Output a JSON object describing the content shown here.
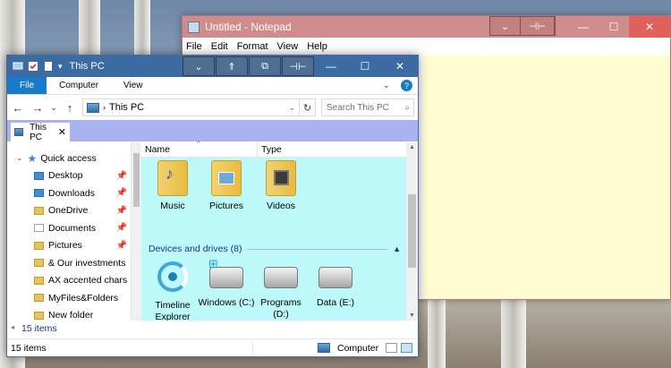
{
  "notepad": {
    "title": "Untitled - Notepad",
    "menu": [
      "File",
      "Edit",
      "Format",
      "View",
      "Help"
    ],
    "extra_buttons": [
      "chevron",
      "pin"
    ],
    "text_bg": "#fffdcf"
  },
  "explorer": {
    "title": "This PC",
    "ribbon_tabs": [
      "File",
      "Computer",
      "View"
    ],
    "address": "This PC",
    "search_placeholder": "Search This PC",
    "tab_label": "This PC",
    "nav_items": [
      {
        "label": "Quick access",
        "icon": "star-icon"
      },
      {
        "label": "Desktop",
        "pinned": true
      },
      {
        "label": "Downloads",
        "pinned": true
      },
      {
        "label": "OneDrive",
        "pinned": true
      },
      {
        "label": "Documents",
        "pinned": true
      },
      {
        "label": "Pictures",
        "pinned": true
      },
      {
        "label": "& Our investments"
      },
      {
        "label": "AX accented chars"
      },
      {
        "label": "MyFiles&Folders"
      },
      {
        "label": "New folder"
      }
    ],
    "columns": {
      "name": "Name",
      "type": "Type"
    },
    "folders": [
      "Music",
      "Pictures",
      "Videos"
    ],
    "group_header": "Devices and drives (8)",
    "drives": [
      "Timeline Explorer",
      "Windows (C:)",
      "Programs (D:)",
      "Data (E:)"
    ],
    "items_count_top": "15 items",
    "status_count": "15 items",
    "status_location": "Computer",
    "content_bg": "#bdf9f8",
    "tabs_bg": "#a9b3f0"
  }
}
